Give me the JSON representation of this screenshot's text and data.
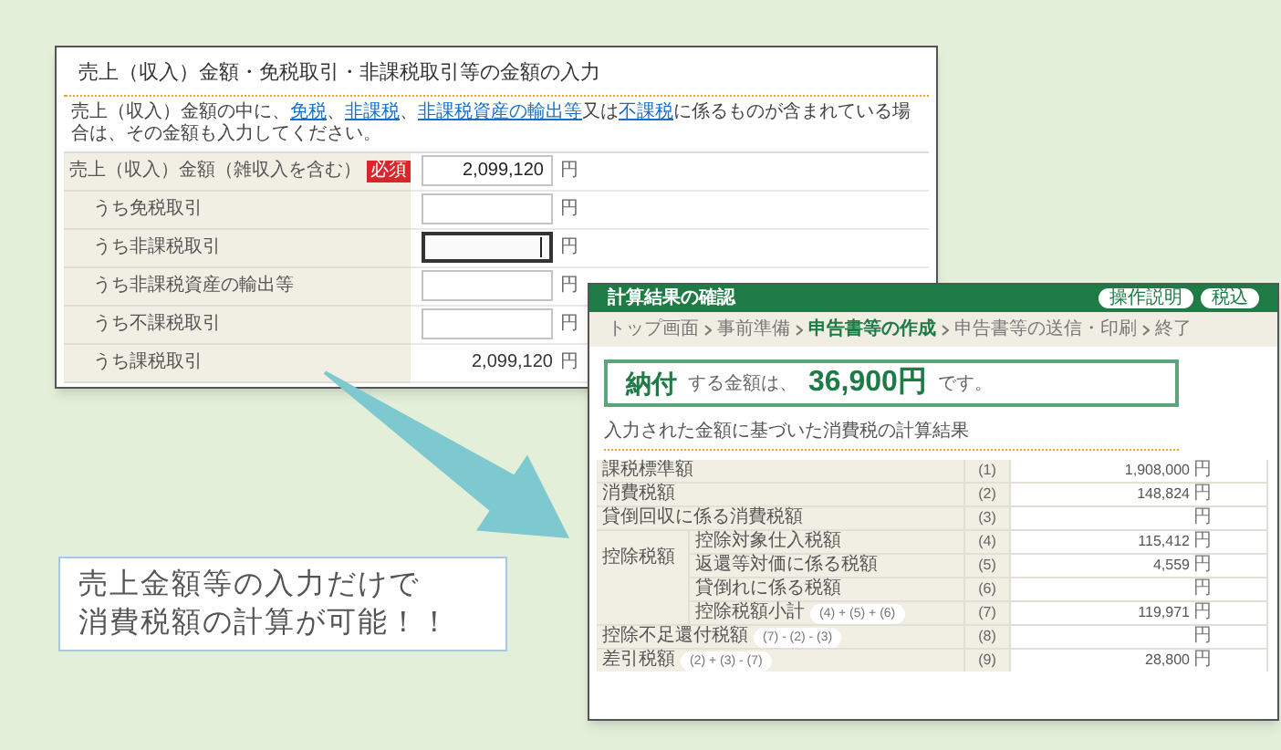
{
  "input_panel": {
    "title": "売上（収入）金額・免税取引・非課税取引等の金額の入力",
    "description": [
      {
        "text": "売上（収入）金額の中に、",
        "link": false
      },
      {
        "text": "免税",
        "link": true
      },
      {
        "text": "、",
        "link": false
      },
      {
        "text": "非課税",
        "link": true
      },
      {
        "text": "、",
        "link": false
      },
      {
        "text": "非課税資産の輸出等",
        "link": true
      },
      {
        "text": "又は",
        "link": false
      },
      {
        "text": "不課税",
        "link": true
      },
      {
        "text": "に係るものが含まれている場合は、その金額も入力してください。",
        "link": false
      }
    ],
    "rows": [
      {
        "label": "売上（収入）金額（雑収入を含む）",
        "badge": "必須",
        "kind": "input",
        "value": "2,099,120",
        "unit": "円",
        "focused": false,
        "children": [
          {
            "label": "うち免税取引",
            "kind": "input",
            "unit": "円",
            "focused": false
          },
          {
            "label": "うち非課税取引",
            "kind": "input",
            "unit": "円",
            "focused": true
          },
          {
            "label": "うち非課税資産の輸出等",
            "kind": "input",
            "unit": "円",
            "focused": false
          },
          {
            "label": "うち不課税取引",
            "kind": "input",
            "unit": "円",
            "focused": false
          },
          {
            "label": "うち課税取引",
            "kind": "text",
            "value": "2,099,120",
            "unit": "円"
          }
        ]
      }
    ]
  },
  "caption": {
    "lines": [
      "売上金額等の入力だけで",
      "消費税額の計算が可能！！"
    ]
  },
  "result_panel": {
    "title": "計算結果の確認",
    "buttons": [
      "操作説明",
      "税込"
    ],
    "breadcrumb": [
      {
        "label": "トップ画面",
        "current": false
      },
      {
        "label": "事前準備",
        "current": false
      },
      {
        "label": "申告書等の作成",
        "current": true
      },
      {
        "label": "申告書等の送信・印刷",
        "current": false
      },
      {
        "label": "終了",
        "current": false
      }
    ],
    "result": {
      "label": "納付",
      "prefix": "する金額は、",
      "amount": "36,900円",
      "suffix": "です。"
    },
    "heading": "入力された金額に基づいた消費税の計算結果",
    "rows": [
      {
        "label": "課税標準額",
        "no": "(1)",
        "value": "1,908,000",
        "unit": "円"
      },
      {
        "label": "消費税額",
        "no": "(2)",
        "value": "148,824",
        "unit": "円"
      },
      {
        "label": "貸倒回収に係る消費税額",
        "no": "(3)",
        "unit": "円"
      },
      {
        "label": "控除税額",
        "children": [
          {
            "label": "控除対象仕入税額",
            "no": "(4)",
            "value": "115,412",
            "unit": "円"
          },
          {
            "label": "返還等対価に係る税額",
            "no": "(5)",
            "value": "4,559",
            "unit": "円"
          },
          {
            "label": "貸倒れに係る税額",
            "no": "(6)",
            "unit": "円"
          },
          {
            "label": "控除税額小計",
            "formula": "(4) + (5) + (6)",
            "no": "(7)",
            "value": "119,971",
            "unit": "円"
          }
        ]
      },
      {
        "label": "控除不足還付税額",
        "formula": "(7) - (2) - (3)",
        "no": "(8)",
        "unit": "円"
      },
      {
        "label": "差引税額",
        "formula": "(2) + (3) - (7)",
        "no": "(9)",
        "value": "28,800",
        "unit": "円"
      }
    ]
  }
}
